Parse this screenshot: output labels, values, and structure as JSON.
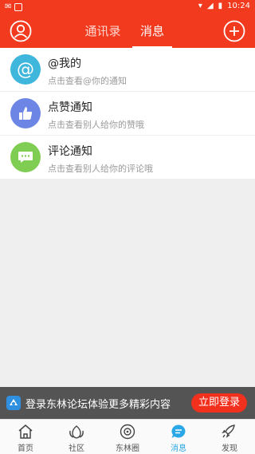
{
  "status_bar": {
    "time": "10:24"
  },
  "header": {
    "tabs": [
      {
        "label": "通讯录",
        "active": false
      },
      {
        "label": "消息",
        "active": true
      }
    ]
  },
  "messages": [
    {
      "title": "@我的",
      "subtitle": "点击查看@你的通知",
      "icon": "at-icon",
      "color": "#3fb6dc"
    },
    {
      "title": "点赞通知",
      "subtitle": "点击查看别人给你的赞哦",
      "icon": "thumbs-up-icon",
      "color": "#6d86e6"
    },
    {
      "title": "评论通知",
      "subtitle": "点击查看别人给你的评论哦",
      "icon": "comment-icon",
      "color": "#7fcd52"
    }
  ],
  "banner": {
    "text": "登录东林论坛体验更多精彩内容",
    "button_label": "立即登录"
  },
  "tabbar": {
    "items": [
      {
        "label": "首页",
        "icon": "home-icon",
        "active": false
      },
      {
        "label": "社区",
        "icon": "community-icon",
        "active": false
      },
      {
        "label": "东林圈",
        "icon": "circle-icon",
        "active": false
      },
      {
        "label": "消息",
        "icon": "message-icon",
        "active": true
      },
      {
        "label": "发现",
        "icon": "rocket-icon",
        "active": false
      }
    ]
  },
  "colors": {
    "brand": "#f23a1e",
    "accent": "#2aa7e6"
  }
}
